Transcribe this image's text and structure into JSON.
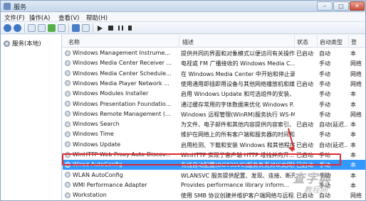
{
  "window": {
    "title": "服务"
  },
  "menu": [
    "文件(F)",
    "操作(A)",
    "查看(V)",
    "帮助(H)"
  ],
  "tree": {
    "root_label": "服务(本地)"
  },
  "columns": {
    "name": "名称",
    "description": "描述",
    "status": "状态",
    "startup": "启动类型",
    "logon": "登"
  },
  "rows": [
    {
      "name": "Windows Management Instrume...",
      "description": "提供共同的界面和对象模式以便访问有关操作...",
      "status": "已启动",
      "startup": "自动",
      "logon": "本"
    },
    {
      "name": "Windows Media Center Receiver ...",
      "description": "电视或 FM 广播接收的 Windows Media C...",
      "status": "",
      "startup": "手动",
      "logon": "网络"
    },
    {
      "name": "Windows Media Center Schedule...",
      "description": "在 Windows Media Center 中开始和停止录...",
      "status": "",
      "startup": "手动",
      "logon": "网络"
    },
    {
      "name": "Windows Media Player Network ...",
      "description": "使用通用即插即用设备与其他网络播放机和媒...",
      "status": "已启动",
      "startup": "手动",
      "logon": "网络"
    },
    {
      "name": "Windows Modules Installer",
      "description": "启用 Windows Update 和可选组件的安装、...",
      "status": "",
      "startup": "手动",
      "logon": "本"
    },
    {
      "name": "Windows Presentation Foundatio...",
      "description": "通过缓存常用的字体数据来优化 Windows P...",
      "status": "",
      "startup": "手动",
      "logon": "本"
    },
    {
      "name": "Windows Remote Management (...",
      "description": "Windows 远程管理(WinRM)服务执行 WS-M...",
      "status": "",
      "startup": "手动",
      "logon": "网络"
    },
    {
      "name": "Windows Search",
      "description": "为文件、电子邮件和其他内容提供内容索引、...",
      "status": "已启动",
      "startup": "自动(延迟...",
      "logon": "本"
    },
    {
      "name": "Windows Time",
      "description": "维护在网络上的所有客户端和服务器的时间和...",
      "status": "",
      "startup": "手动",
      "logon": "本"
    },
    {
      "name": "Windows Update",
      "description": "启用检测、下载和安装 Windows 和其他程序...",
      "status": "已启动",
      "startup": "自动(延迟...",
      "logon": "本"
    },
    {
      "name": "WinHTTP Web Proxy Auto-Discov...",
      "description": "WinHTTP 实现了客户端 HTTP 堆栈并向开...",
      "status": "已启动",
      "startup": "手动",
      "logon": "本"
    },
    {
      "name": "Wired AutoConfig",
      "description": "有线自动配置(DOT3SVC)服务负责对以太网接...",
      "status": "已启动",
      "startup": "手动",
      "logon": "本",
      "selected": true
    },
    {
      "name": "WLAN AutoConfig",
      "description": "WLANSVC 服务提供配置、发现、连接、断开...",
      "status": "",
      "startup": "手动",
      "logon": "本"
    },
    {
      "name": "WMI Performance Adapter",
      "description": "Provides performance library inform...",
      "status": "",
      "startup": "手动",
      "logon": "本"
    },
    {
      "name": "Workstation",
      "description": "使用 SMB 协议创建并维护客户端网络与远程...",
      "status": "已启动",
      "startup": "自动",
      "logon": "网络"
    }
  ],
  "watermark": {
    "main": "查字典",
    "sub": "教程网"
  }
}
